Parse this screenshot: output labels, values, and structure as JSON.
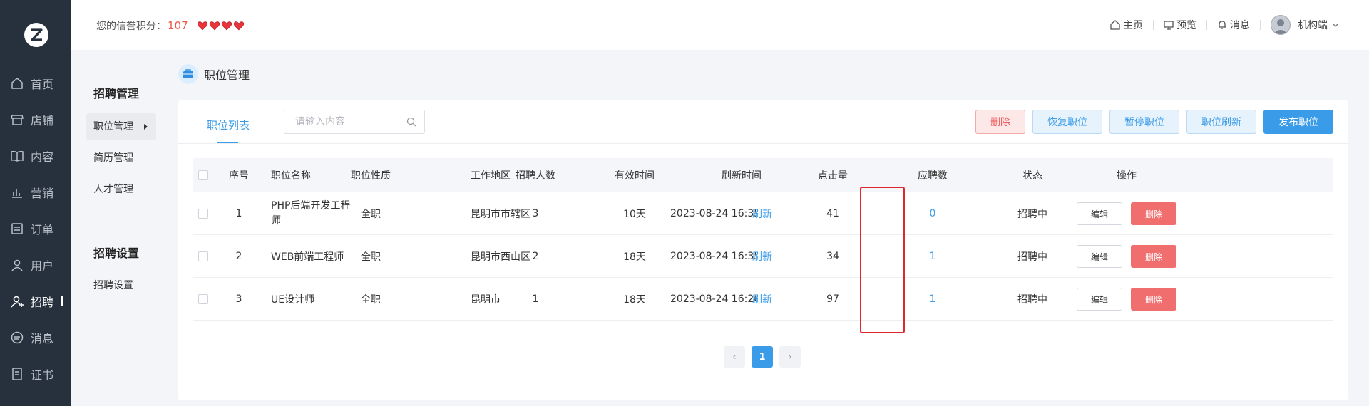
{
  "nav": {
    "items": [
      {
        "label": "首页",
        "icon": "home-icon"
      },
      {
        "label": "店铺",
        "icon": "store-icon"
      },
      {
        "label": "内容",
        "icon": "book-icon"
      },
      {
        "label": "营销",
        "icon": "chart-icon"
      },
      {
        "label": "订单",
        "icon": "order-icon"
      },
      {
        "label": "用户",
        "icon": "user-icon"
      },
      {
        "label": "招聘",
        "icon": "recruit-icon",
        "active": true
      },
      {
        "label": "消息",
        "icon": "message-icon"
      },
      {
        "label": "证书",
        "icon": "certificate-icon"
      }
    ]
  },
  "topbar": {
    "credit_label": "您的信誉积分：",
    "credit_value": "107",
    "hearts": 4,
    "home": "主页",
    "preview": "预览",
    "message": "消息",
    "user": "机构端"
  },
  "subnav": {
    "group1_title": "招聘管理",
    "group1_items": [
      "职位管理",
      "简历管理",
      "人才管理"
    ],
    "group2_title": "招聘设置",
    "group2_items": [
      "招聘设置"
    ]
  },
  "breadcrumb": "职位管理",
  "toolbar": {
    "tab": "职位列表",
    "search_placeholder": "请输入内容",
    "delete": "删除",
    "restore": "恢复职位",
    "pause": "暂停职位",
    "refresh": "职位刷新",
    "publish": "发布职位"
  },
  "table": {
    "headers": [
      "序号",
      "职位名称",
      "职位性质",
      "工作地区",
      "招聘人数",
      "有效时间",
      "刷新时间",
      "点击量",
      "应聘数",
      "状态",
      "操作"
    ],
    "rows": [
      {
        "no": "1",
        "name": "PHP后端开发工程师",
        "type": "全职",
        "area": "昆明市市辖区",
        "count": "3",
        "valid": "10天",
        "time": "2023-08-24 16:35",
        "refresh": "刷新",
        "clicks": "41",
        "applies": "0",
        "status": "招聘中",
        "edit": "编辑",
        "del": "删除"
      },
      {
        "no": "2",
        "name": "WEB前端工程师",
        "type": "全职",
        "area": "昆明市西山区",
        "count": "2",
        "valid": "18天",
        "time": "2023-08-24 16:35",
        "refresh": "刷新",
        "clicks": "34",
        "applies": "1",
        "status": "招聘中",
        "edit": "编辑",
        "del": "删除"
      },
      {
        "no": "3",
        "name": "UE设计师",
        "type": "全职",
        "area": "昆明市",
        "count": "1",
        "valid": "18天",
        "time": "2023-08-24 16:26",
        "refresh": "刷新",
        "clicks": "97",
        "applies": "1",
        "status": "招聘中",
        "edit": "编辑",
        "del": "删除"
      }
    ]
  },
  "pagination": {
    "current": "1",
    "prev": "‹",
    "next": "›"
  },
  "colors": {
    "primary": "#3a9be8",
    "danger": "#f06e6e",
    "nav_bg": "#27313d",
    "highlight": "#e0262b"
  }
}
